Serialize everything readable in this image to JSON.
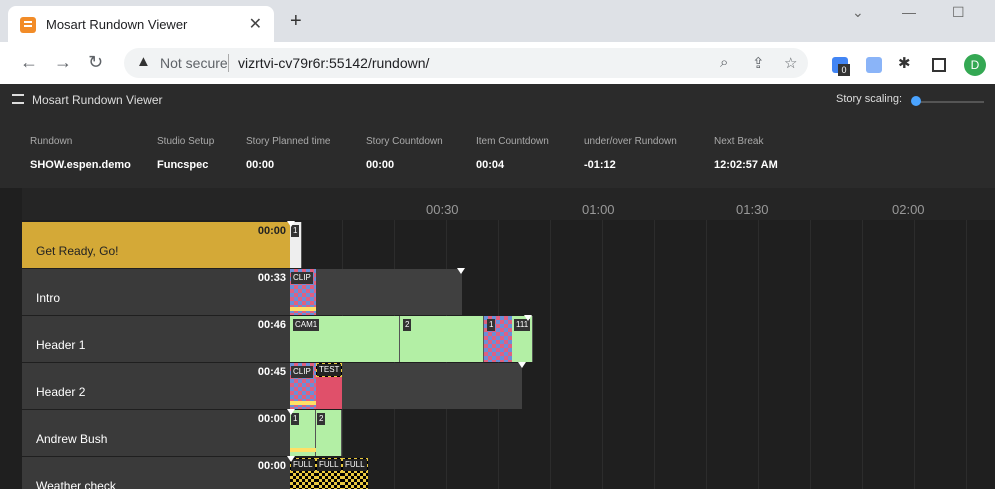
{
  "browser": {
    "tab_title": "Mosart Rundown Viewer",
    "not_secure": "Not secure",
    "url": "vizrtvi-cv79r6r:55142/rundown/",
    "profile_initial": "D",
    "ext_badge": "0"
  },
  "app": {
    "name": "Mosart Rundown Viewer",
    "story_scaling_label": "Story scaling:"
  },
  "info": [
    {
      "label": "Rundown",
      "value": "SHOW.espen.demo"
    },
    {
      "label": "Studio Setup",
      "value": "Funcspec"
    },
    {
      "label": "Story Planned time",
      "value": "00:00"
    },
    {
      "label": "Story Countdown",
      "value": "00:00"
    },
    {
      "label": "Item Countdown",
      "value": "00:04"
    },
    {
      "label": "under/over Rundown",
      "value": "-01:12"
    },
    {
      "label": "Next Break",
      "value": "12:02:57 AM"
    }
  ],
  "ruler": [
    "00:30",
    "01:00",
    "01:30",
    "02:00"
  ],
  "stories": [
    {
      "name": "Get Ready, Go!",
      "duration": "00:00"
    },
    {
      "name": "Intro",
      "duration": "00:33"
    },
    {
      "name": "Header 1",
      "duration": "00:46"
    },
    {
      "name": "Header 2",
      "duration": "00:45"
    },
    {
      "name": "Andrew Bush",
      "duration": "00:00"
    },
    {
      "name": "Weather check",
      "duration": "00:00"
    }
  ],
  "items": {
    "get_ready": [
      "1"
    ],
    "intro": [
      "CLIP"
    ],
    "header1": [
      "CAM1",
      "2",
      "1",
      "111"
    ],
    "header2": [
      "CLIP",
      "TEST"
    ],
    "andrew": [
      "1",
      "2"
    ],
    "weather": [
      "FULL",
      "FULL",
      "FULL"
    ]
  },
  "colors": {
    "active_story": "#d4a937",
    "camera_item": "#b3efa5",
    "accent": "#4aa3ff"
  }
}
